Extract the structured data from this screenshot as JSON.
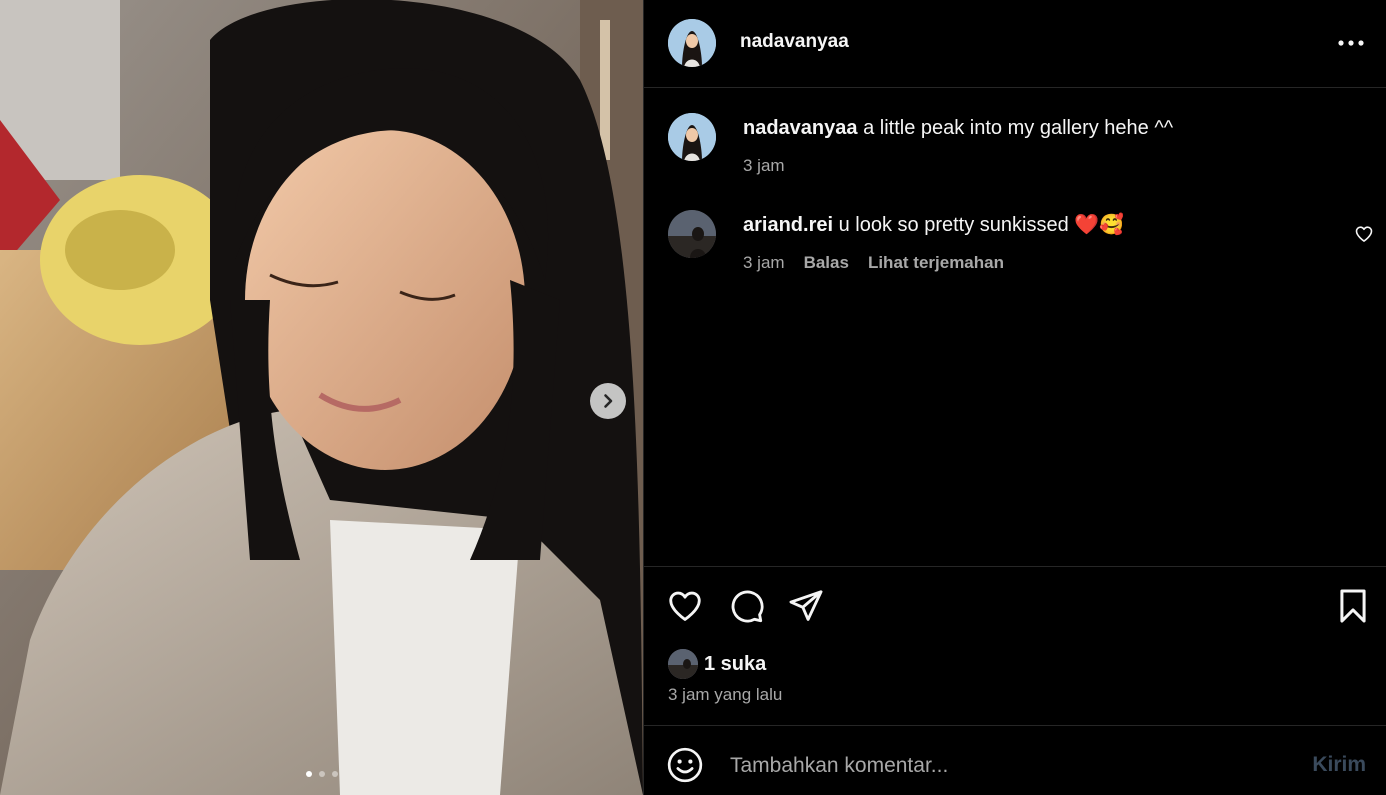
{
  "post": {
    "username": "nadavanyaa",
    "media_dots": 3,
    "active_dot": 0
  },
  "caption": {
    "username": "nadavanyaa",
    "text": "a little peak into my gallery hehe ^^",
    "time": "3 jam"
  },
  "comments": [
    {
      "username": "ariand.rei",
      "text": "u look so pretty sunkissed ❤️🥰",
      "time": "3 jam",
      "reply_label": "Balas",
      "translate_label": "Lihat terjemahan"
    }
  ],
  "likes": {
    "count_label": "1 suka",
    "time_ago": "3 jam yang lalu"
  },
  "composer": {
    "placeholder": "Tambahkan komentar...",
    "send_label": "Kirim"
  },
  "icons": {
    "like": "heart-icon",
    "comment": "comment-bubble-icon",
    "share": "paper-plane-icon",
    "save": "bookmark-icon",
    "more": "more-options-icon",
    "emoji": "smiley-icon",
    "next": "chevron-right-icon"
  },
  "colors": {
    "background": "#000000",
    "text": "#f5f5f5",
    "secondary_text": "#a8a8a8",
    "divider": "#262626",
    "send_disabled": "#3a4a5c"
  }
}
